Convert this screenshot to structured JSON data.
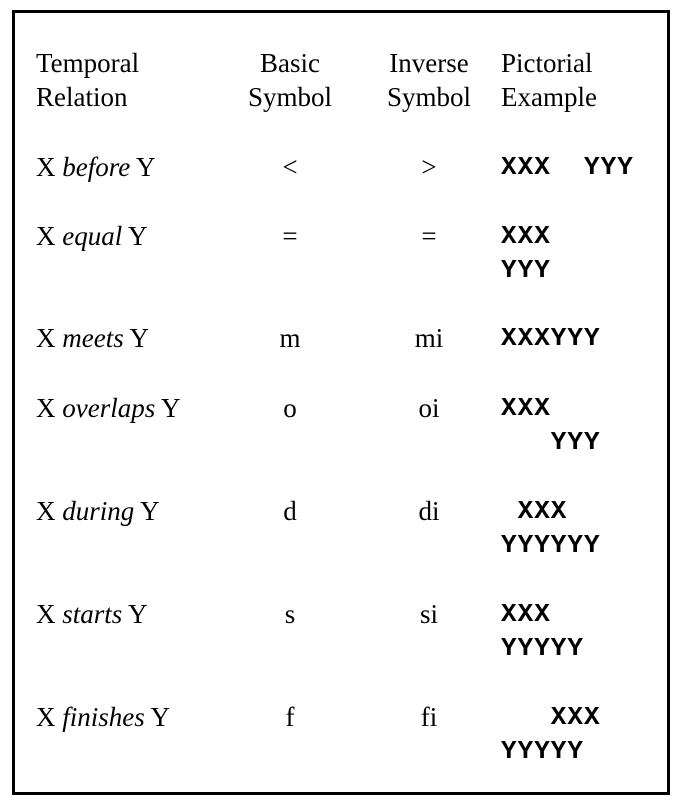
{
  "header": {
    "relation": [
      "Temporal",
      "Relation"
    ],
    "basic": [
      "Basic",
      "Symbol"
    ],
    "inverse": [
      "Inverse",
      "Symbol"
    ],
    "pictorial": [
      "Pictorial",
      "Example"
    ]
  },
  "rows": [
    {
      "x": "X",
      "verb": "before",
      "y": "Y",
      "basic": "<",
      "inverse": ">",
      "pic": [
        "XXX  YYY"
      ]
    },
    {
      "x": "X",
      "verb": "equal",
      "y": "Y",
      "basic": "=",
      "inverse": "=",
      "pic": [
        "XXX",
        "YYY"
      ]
    },
    {
      "x": "X",
      "verb": "meets",
      "y": "Y",
      "basic": "m",
      "inverse": "mi",
      "pic": [
        "XXXYYY"
      ]
    },
    {
      "x": "X",
      "verb": "overlaps",
      "y": "Y",
      "basic": "o",
      "inverse": "oi",
      "pic": [
        "XXX",
        "   YYY"
      ]
    },
    {
      "x": "X",
      "verb": "during",
      "y": "Y",
      "basic": "d",
      "inverse": "di",
      "pic": [
        " XXX",
        "YYYYYY"
      ]
    },
    {
      "x": "X",
      "verb": "starts",
      "y": "Y",
      "basic": "s",
      "inverse": "si",
      "pic": [
        "XXX",
        "YYYYY"
      ]
    },
    {
      "x": "X",
      "verb": "finishes",
      "y": "Y",
      "basic": "f",
      "inverse": "fi",
      "pic": [
        "   XXX",
        "YYYYY"
      ]
    }
  ]
}
